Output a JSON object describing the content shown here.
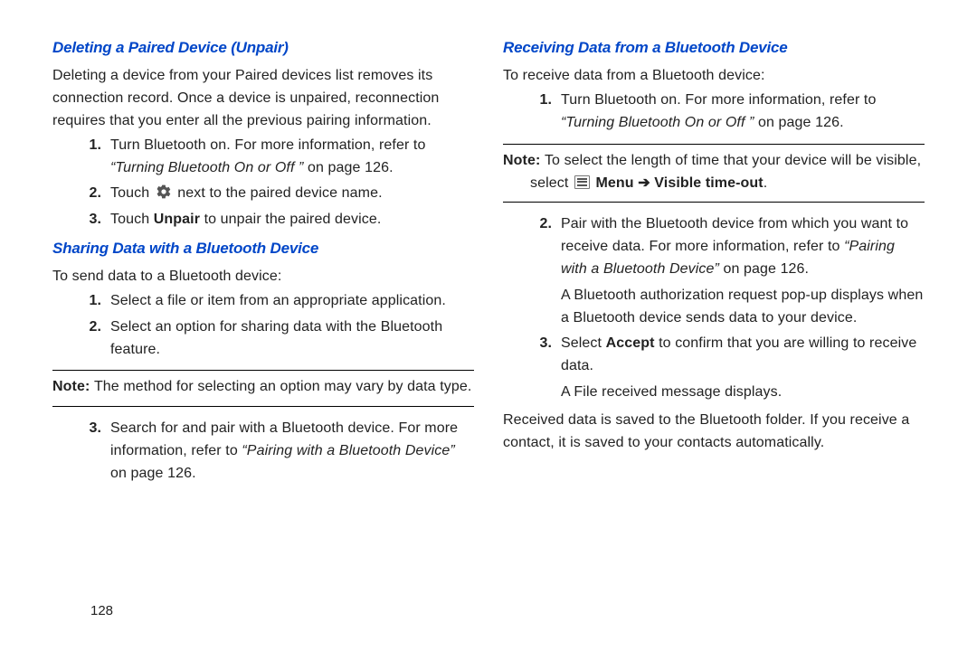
{
  "page_number": "128",
  "left": {
    "section1": {
      "heading": "Deleting a Paired Device (Unpair)",
      "intro": "Deleting a device from your Paired devices list removes its connection record. Once a device is unpaired, reconnection requires that you enter all the previous pairing information.",
      "steps": {
        "s1_a": "Turn Bluetooth on. For more information, refer to ",
        "s1_ref": "“Turning Bluetooth On or Off ”",
        "s1_b": "  on page 126.",
        "s2_a": "Touch ",
        "s2_b": " next to the paired device name.",
        "s3_a": "Touch ",
        "s3_bold": "Unpair",
        "s3_b": " to unpair the paired device."
      }
    },
    "section2": {
      "heading": "Sharing Data with a Bluetooth Device",
      "intro": "To send data to a Bluetooth device:",
      "steps": {
        "s1": "Select a file or item from an appropriate application.",
        "s2": "Select an option for sharing data with the Bluetooth feature."
      },
      "note": "The method for selecting an option may vary by data type.",
      "steps_after": {
        "s3_a": "Search for and pair with a Bluetooth device. For more information, refer to ",
        "s3_ref": "“Pairing with a Bluetooth Device”",
        "s3_b": "  on page 126."
      }
    }
  },
  "right": {
    "section1": {
      "heading": "Receiving Data from a Bluetooth Device",
      "intro": "To receive data from a Bluetooth device:",
      "steps1": {
        "s1_a": "Turn Bluetooth on. For more information, refer to ",
        "s1_ref": "“Turning Bluetooth On or Off ”",
        "s1_b": "  on page 126."
      },
      "note_a": "To select the length of time that your device will be visible, select ",
      "note_menu": "Menu",
      "note_arrow": " ➔ ",
      "note_visible": "Visible time-out",
      "note_end": ".",
      "steps2": {
        "s2_a": "Pair with the Bluetooth device from which you want to receive data. For more information, refer to ",
        "s2_ref": "“Pairing with a Bluetooth Device”",
        "s2_b": "  on page 126.",
        "s2_sub": "A Bluetooth authorization request pop-up displays when a Bluetooth device sends data to your device.",
        "s3_a": "Select ",
        "s3_bold": "Accept",
        "s3_b": " to confirm that you are willing to receive data.",
        "s3_sub": "A File received message displays."
      },
      "outro": "Received data is saved to the Bluetooth folder. If you receive a contact, it is saved to your contacts automatically."
    }
  },
  "labels": {
    "note": "Note: ",
    "n1": "1.",
    "n2": "2.",
    "n3": "3."
  }
}
